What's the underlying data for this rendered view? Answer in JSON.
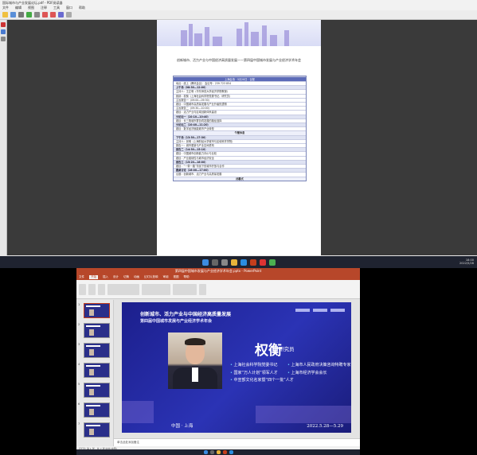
{
  "pdf": {
    "title": "国际城市与产业发展论坛.pdf - PDF阅读器",
    "menu": [
      "文件",
      "编辑",
      "视图",
      "注释",
      "工具",
      "窗口",
      "帮助"
    ],
    "doc_heading": "创新城市、活力产业与中国经济高质量发展——第四届中国城市发展与产业经济学术年会",
    "schedule": [
      {
        "kind": "hdr",
        "text": "上海会场 · 5月28日 · 议程"
      },
      {
        "kind": "row",
        "text": "地点：线上（腾讯会议）  会议号：239 723 854"
      },
      {
        "kind": "sec",
        "text": "上午场（08:30—12:00）"
      },
      {
        "kind": "row",
        "text": "主持人：王正明（华东师范大学经济学院教授）"
      },
      {
        "kind": "row",
        "text": "致辞：权衡（上海社会科学院党委书记、研究员）"
      },
      {
        "kind": "row",
        "text": "主旨报告一（09:00—09:30）"
      },
      {
        "kind": "row",
        "text": "题目：中国城市高质量发展与产业升级的逻辑"
      },
      {
        "kind": "row",
        "text": "主旨报告二（09:30—10:00）"
      },
      {
        "kind": "row",
        "text": "题目：活力产业与区域创新体系建设"
      },
      {
        "kind": "sec",
        "text": "分论坛一（10:10—10:40）"
      },
      {
        "kind": "row",
        "text": "题目：长三角城市群协同发展的路径选择"
      },
      {
        "kind": "sec",
        "text": "分论坛二（10:40—11:20）"
      },
      {
        "kind": "row",
        "text": "题目：数字经济赋能城市产业转型"
      },
      {
        "kind": "center",
        "text": "午餐休息"
      },
      {
        "kind": "sec",
        "text": "下午场（13:30—17:30）"
      },
      {
        "kind": "row",
        "text": "主持人：张明（上海财经大学城市与区域科学学院）"
      },
      {
        "kind": "row",
        "text": "报告一：城市更新与产业空间重构"
      },
      {
        "kind": "sec",
        "text": "报告二（14:30—15:10）"
      },
      {
        "kind": "row",
        "text": "题目：中国城市创新能力评价与比较"
      },
      {
        "kind": "row",
        "text": "题目：产业链韧性与城市经济安全"
      },
      {
        "kind": "sec",
        "text": "报告三（15:20—16:00）"
      },
      {
        "kind": "row",
        "text": "题目：“一带一路”背景下的城市开放与合作"
      },
      {
        "kind": "sec",
        "text": "圆桌讨论（16:00—17:00）"
      },
      {
        "kind": "row",
        "text": "议题：创新城市、活力产业与高质量发展"
      },
      {
        "kind": "center",
        "text": "闭幕式"
      }
    ]
  },
  "taskbar": {
    "time": "18:00",
    "date": "2022/5/28"
  },
  "ppt": {
    "title": "第四届中国城市发展与产业经济学术年会.pptx - PowerPoint",
    "tabs": [
      "文件",
      "开始",
      "插入",
      "设计",
      "切换",
      "动画",
      "幻灯片放映",
      "审阅",
      "视图",
      "帮助"
    ],
    "thumb_numbers": [
      "1",
      "2",
      "3",
      "4",
      "5",
      "6",
      "7"
    ],
    "slide": {
      "title1": "创新城市、活力产业与中国经济高质量发展",
      "title2": "第四届中国城市发展与产业经济学术年会",
      "name": "权衡",
      "role": "研究员",
      "bullets_left": [
        "上海社会科学院党委书记",
        "国家“万人计划”领军人才",
        "中宣部文化名家暨“四个一批”人才"
      ],
      "bullets_right": [
        "上海市人民政府决策咨询特聘专家",
        "上海市经济学会会长"
      ],
      "footer_left": "中国 · 上海",
      "footer_right": "2022.5.28—5.29"
    },
    "notes_placeholder": "单击此处添加备注",
    "status": "幻灯片 第 1 张，共 7 张  中文(中国)"
  }
}
